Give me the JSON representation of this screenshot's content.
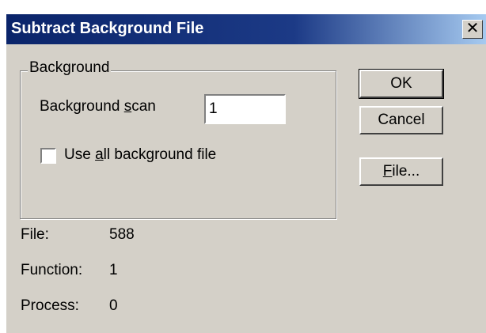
{
  "window": {
    "title": "Subtract Background File",
    "close_glyph": "✕"
  },
  "group": {
    "label": "Background"
  },
  "scan": {
    "label_pre": "Background ",
    "label_accel": "s",
    "label_post": "can",
    "value": "1"
  },
  "use_all": {
    "label_pre": "Use ",
    "label_accel": "a",
    "label_post": "ll background file",
    "checked": false
  },
  "buttons": {
    "ok": "OK",
    "cancel": "Cancel",
    "file_accel": "F",
    "file_rest": "ile..."
  },
  "info": {
    "file_label": "File:",
    "file_value": "588",
    "function_label": "Function:",
    "function_value": "1",
    "process_label": "Process:",
    "process_value": "0"
  }
}
